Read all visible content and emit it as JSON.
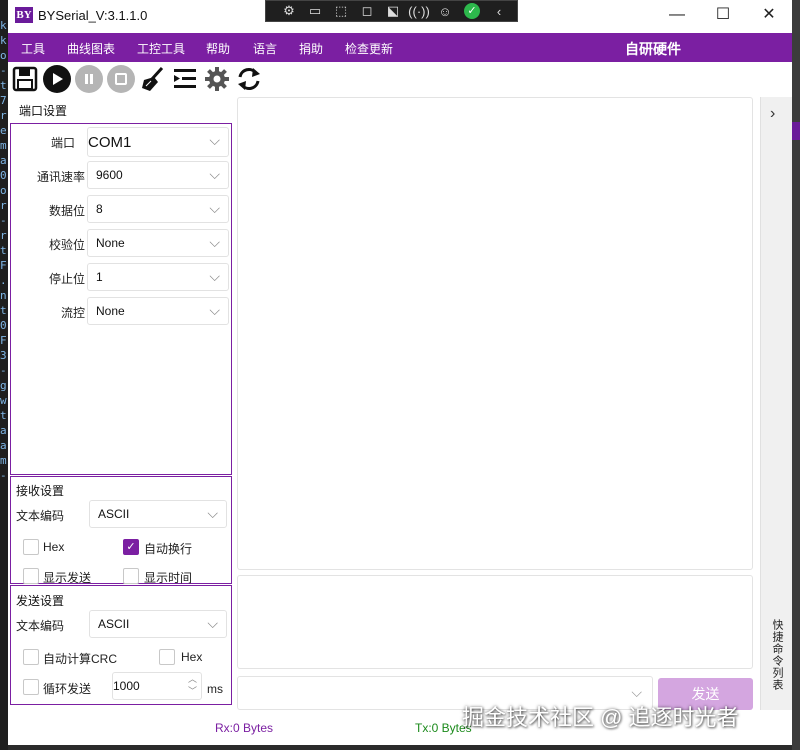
{
  "background_code_chars": [
    "k",
    "k",
    "o",
    "-",
    "t",
    "7",
    "r",
    "e",
    "m",
    "a",
    "0",
    "o",
    "r",
    "-",
    "r",
    "t",
    "F",
    ".",
    "n",
    "t",
    "0",
    "F",
    "3",
    "-",
    "g",
    "w",
    "t",
    "a",
    "a",
    "m",
    "-"
  ],
  "window": {
    "title": "BYSerial_V:3.1.1.0",
    "logo_text": "BY"
  },
  "overlay_toolbar": {
    "icons": [
      "settings-frame-icon",
      "record-icon",
      "cursor-icon",
      "frame-icon",
      "select-icon",
      "wifi-icon",
      "accessibility-icon",
      "check-icon",
      "chevron-left-icon"
    ]
  },
  "window_controls": {
    "minimize": "—",
    "maximize": "☐",
    "close": "✕"
  },
  "menu": {
    "items": [
      "工具",
      "曲线图表",
      "工控工具",
      "帮助",
      "语言",
      "捐助",
      "检查更新"
    ],
    "brand": "自研硬件"
  },
  "toolbar": {
    "icons": [
      "save-icon",
      "play-icon",
      "pause-icon",
      "stop-icon",
      "clear-icon",
      "list-icon",
      "gear-icon",
      "refresh-icon"
    ]
  },
  "port_settings": {
    "title": "端口设置",
    "fields": [
      {
        "label": "端口",
        "value": "COM1"
      },
      {
        "label": "通讯速率",
        "value": "9600"
      },
      {
        "label": "数据位",
        "value": "8"
      },
      {
        "label": "校验位",
        "value": "None"
      },
      {
        "label": "停止位",
        "value": "1"
      },
      {
        "label": "流控",
        "value": "None"
      }
    ]
  },
  "receive_settings": {
    "title": "接收设置",
    "encoding_label": "文本编码",
    "encoding_value": "ASCII",
    "checkboxes": [
      {
        "label": "Hex",
        "checked": false
      },
      {
        "label": "自动换行",
        "checked": true
      },
      {
        "label": "显示发送",
        "checked": false
      },
      {
        "label": "显示时间",
        "checked": false
      }
    ]
  },
  "send_settings": {
    "title": "发送设置",
    "encoding_label": "文本编码",
    "encoding_value": "ASCII",
    "crc_label": "自动计算CRC",
    "hex_label": "Hex",
    "loop_label": "循环发送",
    "interval_value": "1000",
    "interval_unit": "ms"
  },
  "send_button": "发送",
  "side_panel": {
    "label": "快捷命令列表",
    "arrow": "›"
  },
  "status": {
    "rx": "Rx:0 Bytes",
    "tx": "Tx:0 Bytes"
  },
  "watermark": "掘金技术社区 @ 追逐时光者",
  "colors": {
    "accent": "#7b1fa2",
    "send_button": "#d4a6e0",
    "rx_text": "#7b1fa2",
    "tx_text": "#1b8a1b"
  }
}
